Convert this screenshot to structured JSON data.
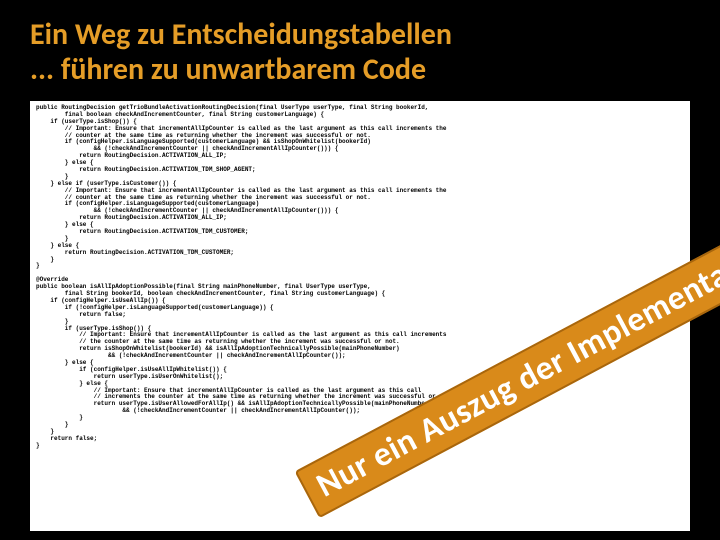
{
  "title": {
    "line1": "Ein Weg zu Entscheidungstabellen",
    "line2": "... führen zu unwartbarem Code"
  },
  "code": "public RoutingDecision getTrioBundleActivationRoutingDecision(final UserType userType, final String bookerId,\n        final boolean checkAndIncrementCounter, final String customerLanguage) {\n    if (userType.isShop()) {\n        // Important: Ensure that incrementAllIpCounter is called as the last argument as this call increments the\n        // counter at the same time as returning whether the increment was successful or not.\n        if (configHelper.isLanguageSupported(customerLanguage) && isShopOnWhitelist(bookerId)\n                && (!checkAndIncrementCounter || checkAndIncrementAllIpCounter())) {\n            return RoutingDecision.ACTIVATION_ALL_IP;\n        } else {\n            return RoutingDecision.ACTIVATION_TDM_SHOP_AGENT;\n        }\n    } else if (userType.isCustomer()) {\n        // Important: Ensure that incrementAllIpCounter is called as the last argument as this call increments the\n        // counter at the same time as returning whether the increment was successful or not.\n        if (configHelper.isLanguageSupported(customerLanguage)\n                && (!checkAndIncrementCounter || checkAndIncrementAllIpCounter())) {\n            return RoutingDecision.ACTIVATION_ALL_IP;\n        } else {\n            return RoutingDecision.ACTIVATION_TDM_CUSTOMER;\n        }\n    } else {\n        return RoutingDecision.ACTIVATION_TDM_CUSTOMER;\n    }\n}\n\n@Override\npublic boolean isAllIpAdoptionPossible(final String mainPhoneNumber, final UserType userType,\n        final String bookerId, boolean checkAndIncrementCounter, final String customerLanguage) {\n    if (configHelper.isUseAllIp()) {\n        if (!configHelper.isLanguageSupported(customerLanguage)) {\n            return false;\n        }\n        if (userType.isShop()) {\n            // Important: Ensure that incrementAllIpCounter is called as the last argument as this call increments\n            // the counter at the same time as returning whether the increment was successful or not.\n            return isShopOnWhitelist(bookerId) && isAllIpAdoptionTechnicallyPossible(mainPhoneNumber)\n                    && (!checkAndIncrementCounter || checkAndIncrementAllIpCounter());\n        } else {\n            if (configHelper.isUseAllIpWhitelist()) {\n                return userType.isUserOnWhitelist();\n            } else {\n                // Important: Ensure that incrementAllIpCounter is called as the last argument as this call\n                // increments the counter at the same time as returning whether the increment was successful or not.\n                return userType.isUserAllowedForAllIp() && isAllIpAdoptionTechnicallyPossible(mainPhoneNumber)\n                        && (!checkAndIncrementCounter || checkAndIncrementAllIpCounter());\n            }\n        }\n    }\n    return false;\n}",
  "stamp_text": "Nur ein Auszug der Implementation"
}
